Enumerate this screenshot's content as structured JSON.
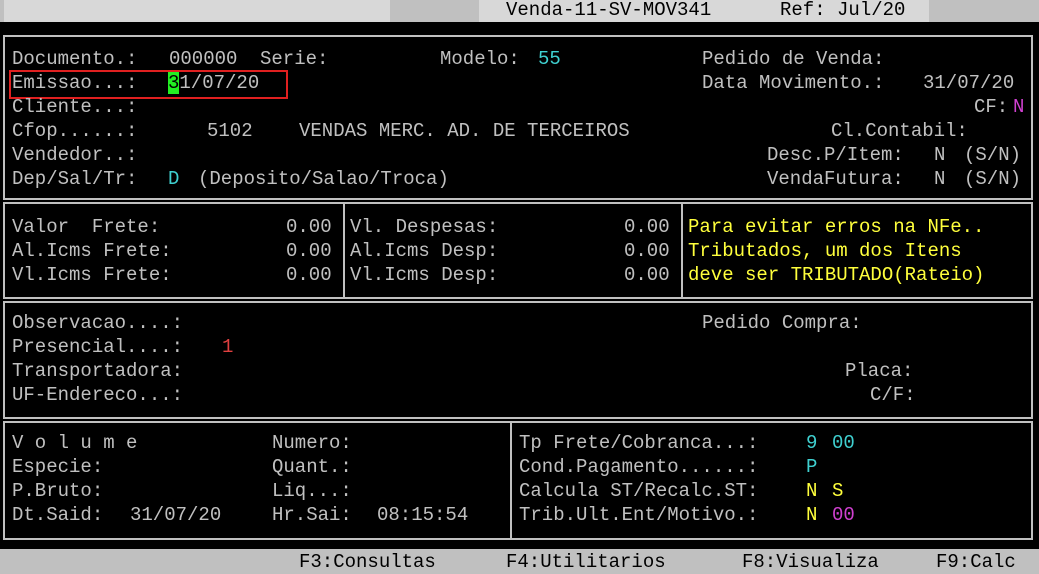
{
  "title_bar": {
    "program": "Venda-11-SV-MOV341",
    "ref": "Ref: Jul/20"
  },
  "header": {
    "documento_label": "Documento.:",
    "documento_value": "000000",
    "serie_label": "Serie:",
    "modelo_label": "Modelo:",
    "modelo_value": "55",
    "pedido_venda_label": "Pedido de Venda:",
    "emissao_label": "Emissao...:",
    "emissao_cursor_char": "3",
    "emissao_rest": "1/07/20",
    "data_mov_label": "Data Movimento.:",
    "data_mov_value": "31/07/20",
    "cliente_label": "Cliente...:",
    "cf_label": "CF:",
    "cf_value": "N",
    "cfop_label": "Cfop......:",
    "cfop_code": "5102",
    "cfop_desc": "VENDAS MERC. AD. DE TERCEIROS",
    "cl_contabil_label": "Cl.Contabil:",
    "vendedor_label": "Vendedor..:",
    "desc_item_label": "Desc.P/Item:",
    "desc_item_value": "N",
    "desc_item_hint": "(S/N)",
    "dep_label": "Dep/Sal/Tr:",
    "dep_value": "D",
    "dep_hint": "(Deposito/Salao/Troca)",
    "venda_futura_label": "VendaFutura:",
    "venda_futura_value": "N",
    "venda_futura_hint": "(S/N)"
  },
  "freight": {
    "valor_frete_label": "Valor  Frete:",
    "valor_frete_value": "0.00",
    "al_icms_frete_label": "Al.Icms Frete:",
    "al_icms_frete_value": "0.00",
    "vl_icms_frete_label": "Vl.Icms Frete:",
    "vl_icms_frete_value": "0.00",
    "vl_despesas_label": "Vl. Despesas:",
    "vl_despesas_value": "0.00",
    "al_icms_desp_label": "Al.Icms Desp:",
    "al_icms_desp_value": "0.00",
    "vl_icms_desp_label": "Vl.Icms Desp:",
    "vl_icms_desp_value": "0.00",
    "warning_lines": [
      "Para evitar erros na NFe..",
      "Tributados, um dos Itens",
      "deve ser TRIBUTADO(Rateio)"
    ]
  },
  "observ": {
    "observacao_label": "Observacao....:",
    "pedido_compra_label": "Pedido Compra:",
    "presencial_label": "Presencial....:",
    "presencial_value": "1",
    "transportadora_label": "Transportadora:",
    "placa_label": "Placa:",
    "uf_endereco_label": "UF-Endereco...:",
    "cf_label": "C/F:"
  },
  "volume": {
    "volume_label": "V o l u m e",
    "numero_label": "Numero:",
    "especie_label": "Especie:",
    "quant_label": "Quant.:",
    "p_bruto_label": "P.Bruto:",
    "liq_label": "Liq...:",
    "dt_said_label": "Dt.Said:",
    "dt_said_value": "31/07/20",
    "hr_sai_label": "Hr.Sai:",
    "hr_sai_value": "08:15:54"
  },
  "payment": {
    "tp_frete_label": "Tp Frete/Cobranca...:",
    "tp_frete_value": "9",
    "cobranca_value": "00",
    "cond_pag_label": "Cond.Pagamento......:",
    "cond_pag_value": "P",
    "calc_st_label": "Calcula ST/Recalc.ST:",
    "calc_st_value": "N",
    "recalc_st_value": "S",
    "trib_label": "Trib.Ult.Ent/Motivo.:",
    "trib_value": "N",
    "motivo_value": "00"
  },
  "function_keys": [
    "F3:Consultas",
    "F4:Utilitarios",
    "F8:Visualiza",
    "F9:Calc"
  ]
}
